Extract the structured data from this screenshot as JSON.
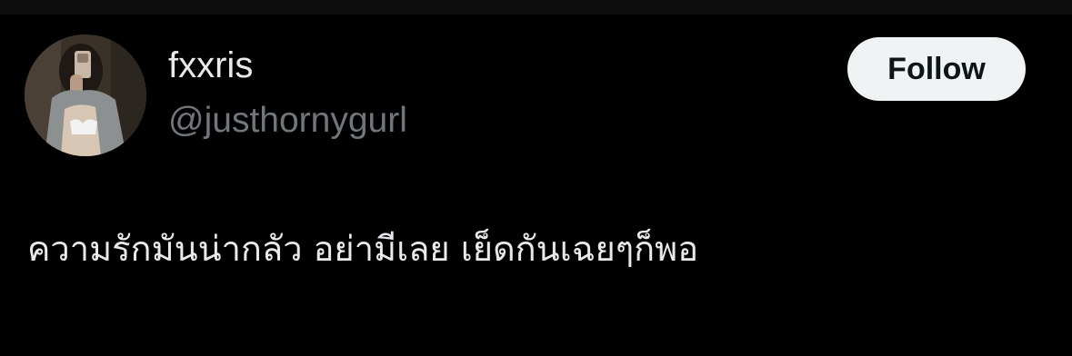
{
  "user": {
    "display_name": "fxxris",
    "handle": "@justhornygurl"
  },
  "follow_button": {
    "label": "Follow"
  },
  "tweet": {
    "text": "ความรักมันน่ากลัว อย่ามีเลย เย็ดกันเฉยๆก็พอ"
  },
  "colors": {
    "background": "#000000",
    "text_primary": "#e7e9ea",
    "text_secondary": "#71767b",
    "button_bg": "#eff3f4",
    "button_text": "#0f1419"
  }
}
